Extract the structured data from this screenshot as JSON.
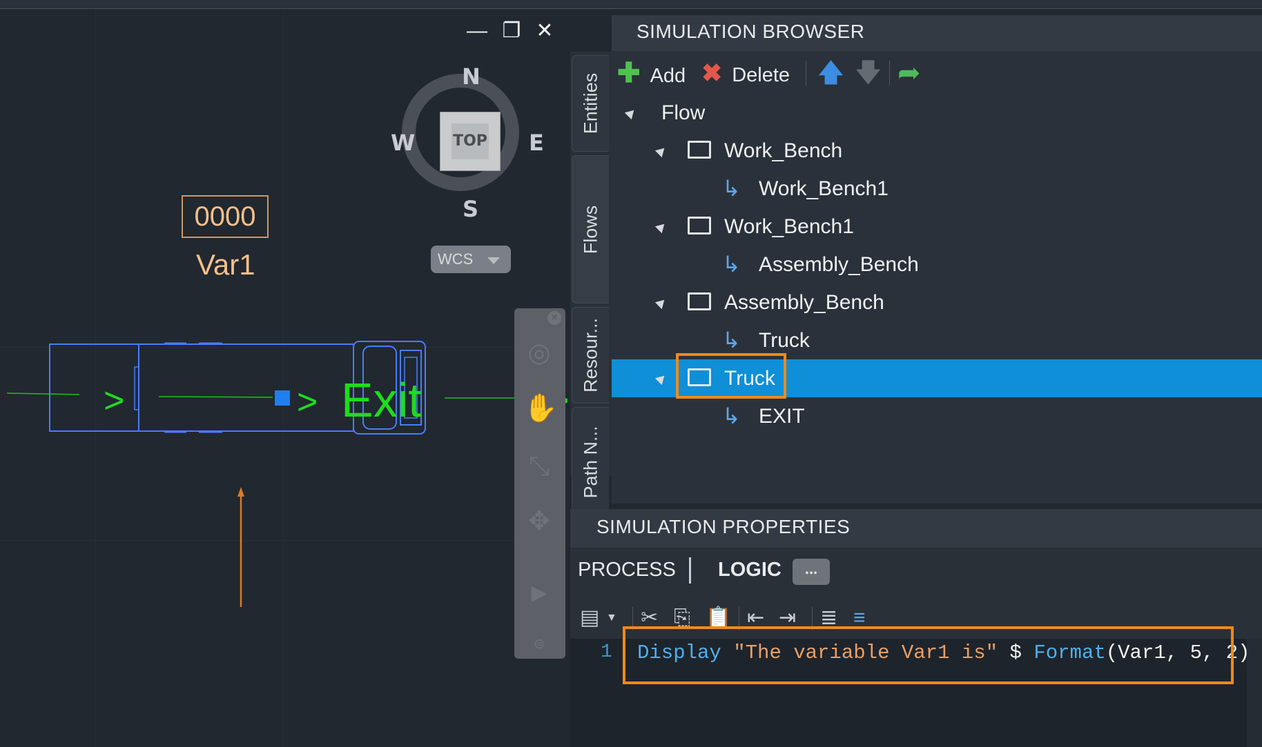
{
  "viewport": {
    "window_buttons": [
      "—",
      "❐",
      "✕"
    ],
    "compass": {
      "n": "N",
      "s": "S",
      "e": "E",
      "w": "W",
      "top": "TOP"
    },
    "wcs_label": "WCS",
    "counter_value": "0000",
    "variable_name": "Var1",
    "canvas_arrows": [
      ">",
      ">",
      ">"
    ],
    "canvas_exit_text": "Exit"
  },
  "side_tabs": [
    "Entities",
    "Flows",
    "Resour...",
    "Path N..."
  ],
  "browser": {
    "title": "SIMULATION BROWSER",
    "toolbar": {
      "add_label": "Add",
      "delete_label": "Delete"
    },
    "tree": {
      "root": "Flow",
      "items": [
        {
          "label": "Work_Bench",
          "kind": "node"
        },
        {
          "label": "Work_Bench1",
          "kind": "link"
        },
        {
          "label": "Work_Bench1",
          "kind": "node"
        },
        {
          "label": "Assembly_Bench",
          "kind": "link"
        },
        {
          "label": "Assembly_Bench",
          "kind": "node"
        },
        {
          "label": "Truck",
          "kind": "link"
        },
        {
          "label": "Truck",
          "kind": "node",
          "selected": true
        },
        {
          "label": "EXIT",
          "kind": "link"
        }
      ]
    }
  },
  "properties": {
    "title": "SIMULATION PROPERTIES",
    "tabs": [
      "PROCESS",
      "LOGIC"
    ],
    "more_label": "...",
    "editor": {
      "line_number": "1",
      "tokens": {
        "display": "Display",
        "string": "\"The variable Var1 is\"",
        "concat": "$",
        "format_fn": "Format",
        "args": "(Var1, 5, 2)"
      }
    }
  },
  "colors": {
    "selection": "#0f8fd8",
    "highlight": "#f08a17",
    "flow_green": "#1edc1e",
    "conveyor_blue": "#4a7cff"
  }
}
